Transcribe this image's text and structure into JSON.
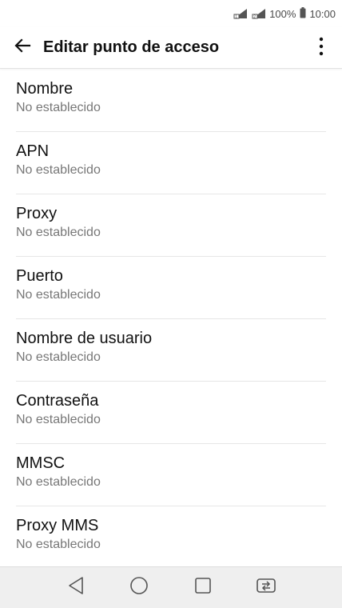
{
  "status_bar": {
    "battery": "100%",
    "time": "10:00",
    "icons": [
      "sim1-signal-icon",
      "sim2-signal-icon",
      "battery-icon"
    ]
  },
  "app_bar": {
    "title": "Editar punto de acceso",
    "back_icon": "arrow-back-icon",
    "menu_icon": "more-vert-icon"
  },
  "items": [
    {
      "title": "Nombre",
      "value": "No establecido"
    },
    {
      "title": "APN",
      "value": "No establecido"
    },
    {
      "title": "Proxy",
      "value": "No establecido"
    },
    {
      "title": "Puerto",
      "value": "No establecido"
    },
    {
      "title": "Nombre de usuario",
      "value": "No establecido"
    },
    {
      "title": "Contraseña",
      "value": "No establecido"
    },
    {
      "title": "MMSC",
      "value": "No establecido"
    },
    {
      "title": "Proxy MMS",
      "value": "No establecido"
    }
  ],
  "nav_bar": {
    "icons": [
      "back-triangle-icon",
      "home-circle-icon",
      "recents-square-icon",
      "dual-window-icon"
    ]
  },
  "colors": {
    "text_primary": "#111111",
    "text_secondary": "#777777",
    "divider": "#e6e6e6",
    "nav_background": "#efefef"
  }
}
